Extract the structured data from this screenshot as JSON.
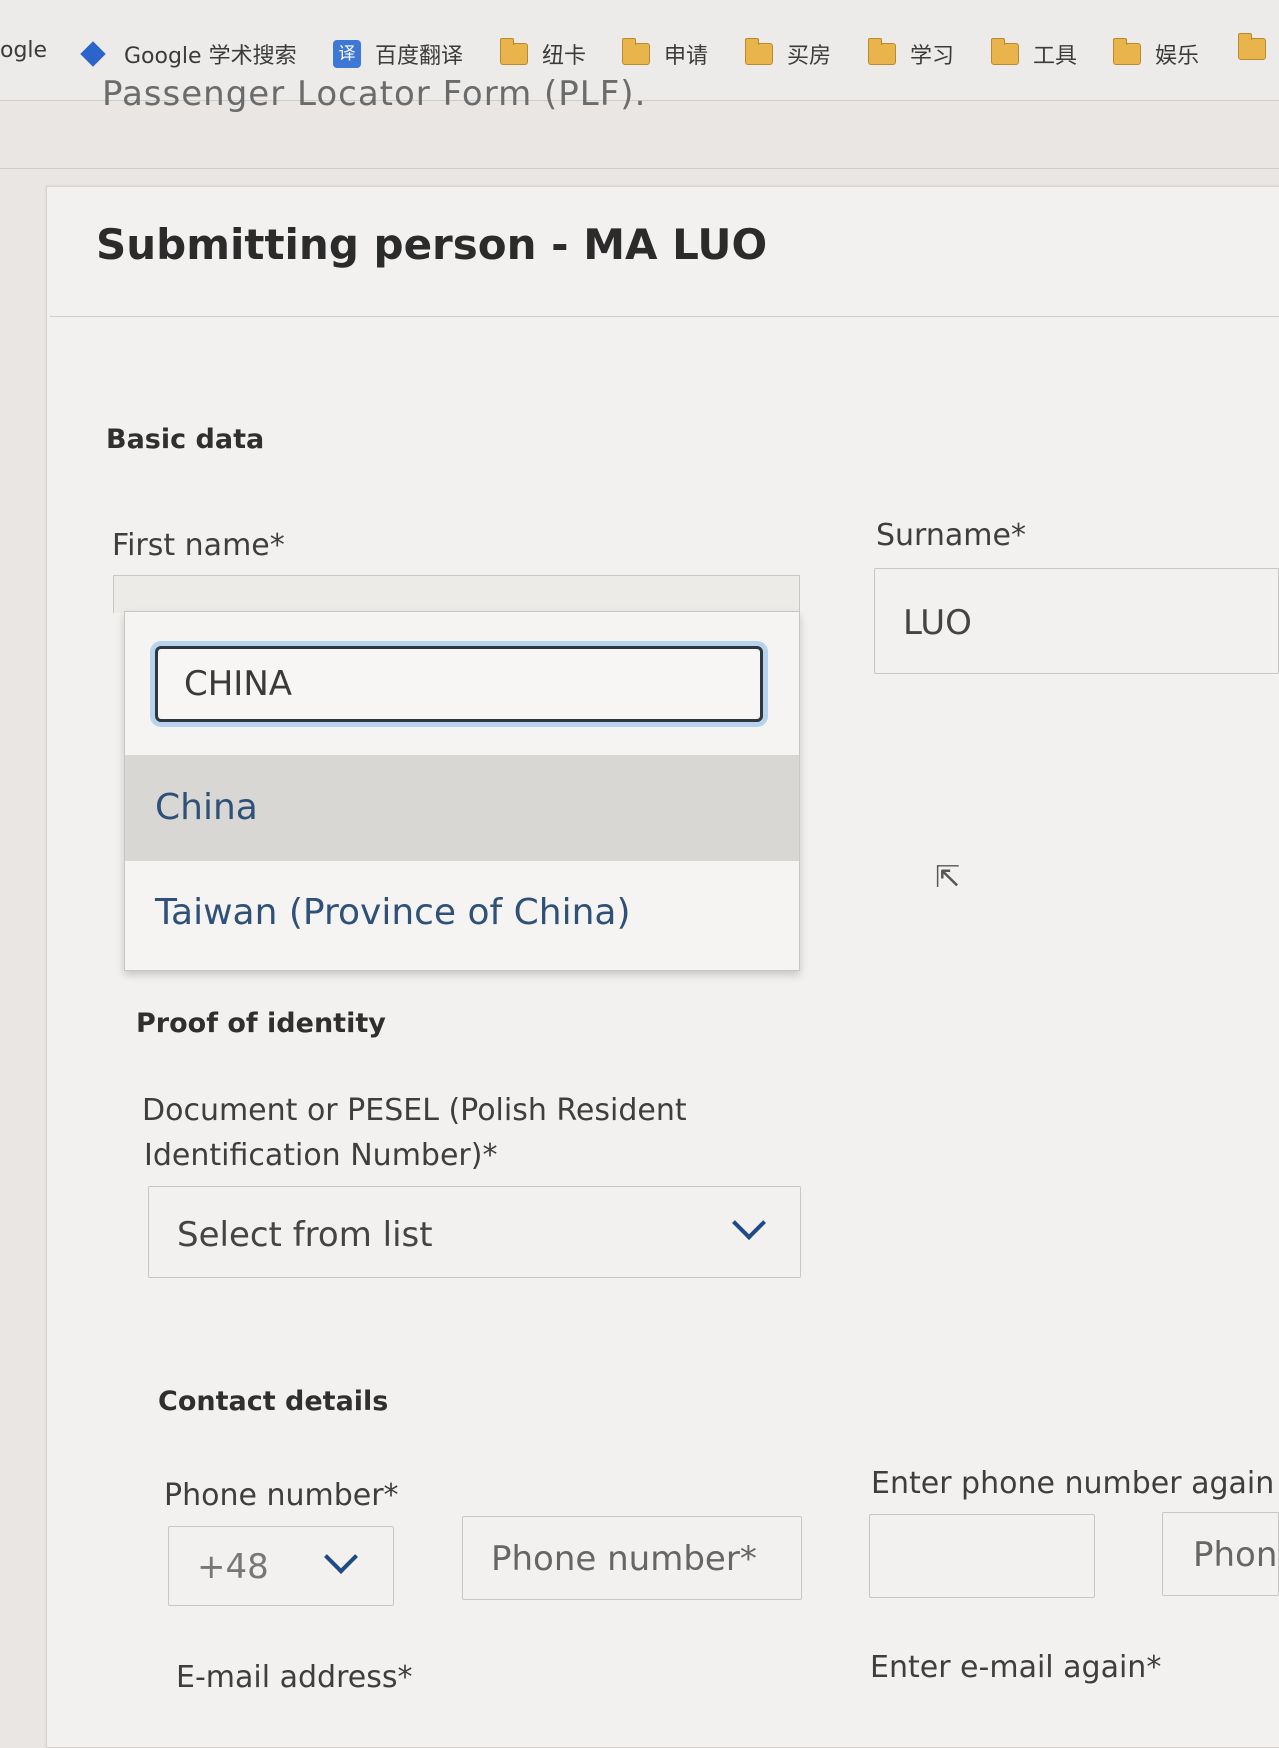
{
  "bookmarks": [
    {
      "label": "ogle",
      "icon": "none"
    },
    {
      "label": "Google 学术搜索",
      "icon": "google-scholar-icon"
    },
    {
      "label": "百度翻译",
      "icon": "baidu-translate-icon",
      "badge": "译"
    },
    {
      "label": "纽卡",
      "icon": "folder-icon"
    },
    {
      "label": "申请",
      "icon": "folder-icon"
    },
    {
      "label": "买房",
      "icon": "folder-icon"
    },
    {
      "label": "学习",
      "icon": "folder-icon"
    },
    {
      "label": "工具",
      "icon": "folder-icon"
    },
    {
      "label": "娱乐",
      "icon": "folder-icon"
    }
  ],
  "page": {
    "partial_heading": "Passenger Locator Form (PLF).",
    "card_title": "Submitting person - MA LUO"
  },
  "basic": {
    "section_title": "Basic data",
    "first_name_label": "First name*",
    "surname_label": "Surname*",
    "surname_value": "LUO",
    "dropdown": {
      "search_value": "CHINA",
      "options": [
        "China",
        "Taiwan (Province of China)"
      ],
      "highlighted": "China"
    }
  },
  "identity": {
    "section_title": "Proof of identity",
    "document_label_line1": "Document or PESEL (Polish Resident",
    "document_label_line2": "Identification Number)*",
    "document_select": "Select from list"
  },
  "contact": {
    "section_title": "Contact details",
    "phone_label": "Phone number*",
    "phone_prefix": "+48",
    "phone_placeholder": "Phone number*",
    "phone_again_label": "Enter phone number again",
    "phone_again_placeholder": "Phon",
    "email_label": "E-mail address*",
    "email_again_label": "Enter e-mail again*"
  }
}
